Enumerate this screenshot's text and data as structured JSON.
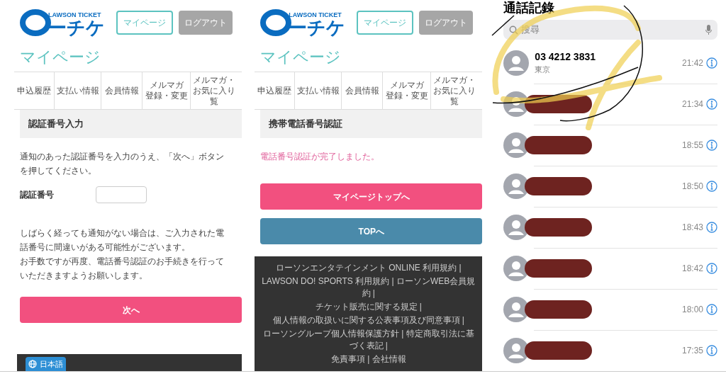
{
  "screens": [
    {
      "logo": {
        "small": "LAWSON TICKET",
        "main": "ーチケ"
      },
      "header_buttons": [
        {
          "label": "マイページ",
          "kind": "outline"
        },
        {
          "label": "ログアウト",
          "kind": "gray"
        }
      ],
      "page_title": "マイページ",
      "tabs": [
        {
          "lines": [
            "申込履歴"
          ]
        },
        {
          "lines": [
            "支払い情報"
          ]
        },
        {
          "lines": [
            "会員情報"
          ]
        },
        {
          "lines": [
            "メルマガ",
            "登録・変更"
          ]
        },
        {
          "lines": [
            "メルマガ・",
            "お気に入り",
            "覧"
          ]
        }
      ],
      "section_title": "認証番号入力",
      "message": {
        "text": "通知のあった認証番号を入力のうえ、「次へ」ボタンを押してください。",
        "kind": "body"
      },
      "field": {
        "label": "認証番号"
      },
      "notes": [
        "しばらく経っても通知がない場合は、ご入力された電話番号に間違いがある可能性がございます。",
        "お手数ですが再度、電話番号認証のお手続きを行っていただきますようお願いします。"
      ],
      "buttons": [
        {
          "label": "次へ",
          "kind": "pink"
        }
      ],
      "footer": {
        "language_button": "日本語"
      }
    },
    {
      "logo": {
        "small": "LAWSON TICKET",
        "main": "ーチケ"
      },
      "header_buttons": [
        {
          "label": "マイページ",
          "kind": "outline"
        },
        {
          "label": "ログアウト",
          "kind": "gray"
        }
      ],
      "page_title": "マイページ",
      "tabs": [
        {
          "lines": [
            "申込履歴"
          ]
        },
        {
          "lines": [
            "支払い情報"
          ]
        },
        {
          "lines": [
            "会員情報"
          ]
        },
        {
          "lines": [
            "メルマガ",
            "登録・変更"
          ]
        },
        {
          "lines": [
            "メルマガ・",
            "お気に入り",
            "覧"
          ]
        }
      ],
      "section_title": "携帯電話番号認証",
      "message": {
        "text": "電話番号認証が完了しました。",
        "kind": "success"
      },
      "buttons": [
        {
          "label": "マイページトップへ",
          "kind": "pink"
        },
        {
          "label": "TOPへ",
          "kind": "blue"
        }
      ],
      "footer": {
        "links": [
          "ローソンエンタテインメント ONLINE 利用規約 |",
          "LAWSON DO! SPORTS 利用規約 |  ローソンWEB会員規約 |",
          "チケット販売に関する規定 |",
          "個人情報の取扱いに関する公表事項及び同意事項 |",
          "ローソングループ個人情報保護方針 | 特定商取引法に基づく表記 |",
          "免責事項 |  会社情報"
        ]
      }
    }
  ],
  "call_log": {
    "title": "通話記錄",
    "search": {
      "placeholder": "搜尋"
    },
    "calls": [
      {
        "number": "03 4212 3831",
        "location": "東京",
        "time": "21:42",
        "redacted": false
      },
      {
        "time": "21:34",
        "redacted": true
      },
      {
        "time": "18:55",
        "redacted": true
      },
      {
        "time": "18:50",
        "redacted": true
      },
      {
        "time": "18:43",
        "redacted": true
      },
      {
        "time": "18:42",
        "redacted": true
      },
      {
        "time": "18:00",
        "redacted": true
      },
      {
        "time": "17:35",
        "redacted": true
      }
    ]
  }
}
